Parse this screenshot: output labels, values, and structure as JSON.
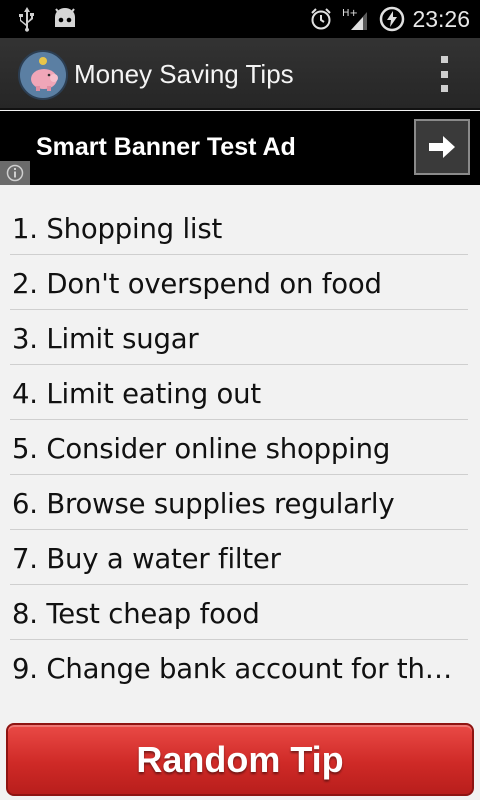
{
  "status_bar": {
    "time": "23:26",
    "icons": [
      "usb-icon",
      "android-debug-icon",
      "alarm-icon",
      "signal-hplus-icon",
      "battery-charging-icon"
    ]
  },
  "action_bar": {
    "title": "Money Saving Tips",
    "app_icon": "piggy-bank-icon",
    "overflow_icon": "overflow-menu-icon"
  },
  "ad_banner": {
    "text": "Smart Banner Test Ad",
    "arrow_icon": "arrow-right-icon",
    "info_icon": "info-icon"
  },
  "tips": [
    {
      "label": "1. Shopping list"
    },
    {
      "label": "2. Don't overspend on food"
    },
    {
      "label": "3. Limit sugar"
    },
    {
      "label": "4. Limit eating out"
    },
    {
      "label": "5. Consider online shopping"
    },
    {
      "label": "6. Browse supplies regularly"
    },
    {
      "label": "7. Buy a water filter"
    },
    {
      "label": "8. Test cheap food"
    },
    {
      "label": "9. Change bank account for the…"
    }
  ],
  "random_button": {
    "label": "Random Tip"
  },
  "colors": {
    "status_bar_bg": "#000000",
    "action_bar_bg": "#2c2c2c",
    "list_bg": "#f2f2f2",
    "button_red": "#d9302c"
  }
}
